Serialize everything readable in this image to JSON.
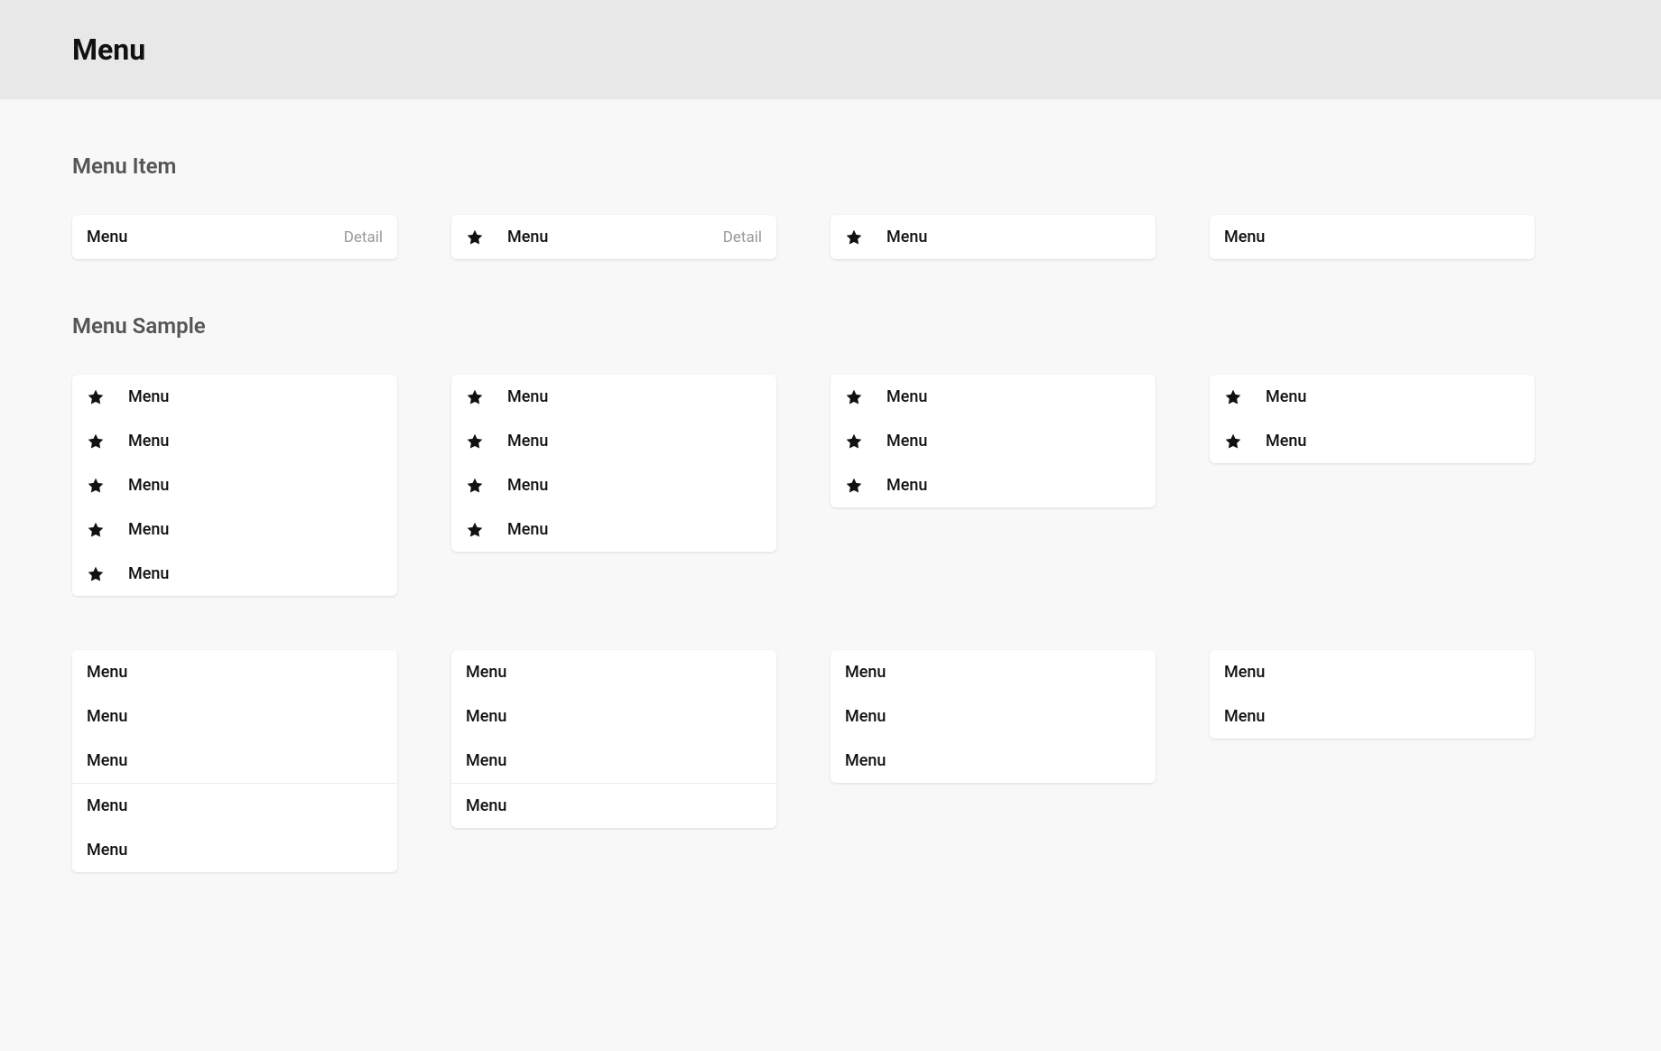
{
  "page": {
    "title": "Menu"
  },
  "sections": {
    "menu_item": {
      "title": "Menu Item",
      "variants": {
        "with_detail": {
          "label": "Menu",
          "detail": "Detail"
        },
        "with_icon_detail": {
          "label": "Menu",
          "detail": "Detail"
        },
        "with_icon": {
          "label": "Menu"
        },
        "plain": {
          "label": "Menu"
        }
      }
    },
    "menu_sample": {
      "title": "Menu Sample",
      "icon_samples": {
        "five": [
          "Menu",
          "Menu",
          "Menu",
          "Menu",
          "Menu"
        ],
        "four": [
          "Menu",
          "Menu",
          "Menu",
          "Menu"
        ],
        "three": [
          "Menu",
          "Menu",
          "Menu"
        ],
        "two": [
          "Menu",
          "Menu"
        ]
      },
      "plain_samples": {
        "five": {
          "group_a": [
            "Menu",
            "Menu",
            "Menu"
          ],
          "group_b": [
            "Menu",
            "Menu"
          ]
        },
        "four": {
          "group_a": [
            "Menu",
            "Menu",
            "Menu"
          ],
          "group_b": [
            "Menu"
          ]
        },
        "three": [
          "Menu",
          "Menu",
          "Menu"
        ],
        "two": [
          "Menu",
          "Menu"
        ]
      }
    }
  }
}
